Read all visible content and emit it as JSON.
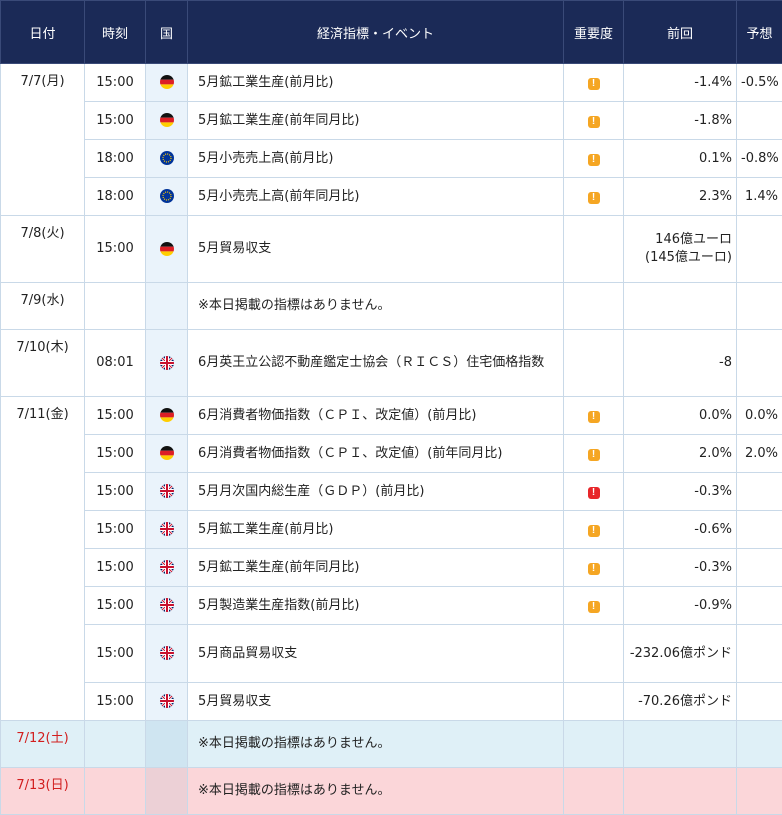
{
  "header": {
    "date": "日付",
    "time": "時刻",
    "country": "国",
    "event": "経済指標・イベント",
    "importance": "重要度",
    "previous": "前回",
    "forecast": "予想"
  },
  "icons": {
    "de": "germany-flag-icon",
    "eu": "eu-flag-icon",
    "gb": "uk-flag-icon",
    "importance_medium_color": "#f5a623",
    "importance_high_color": "#e8262a"
  },
  "days": [
    {
      "date": "7/7(月)",
      "rows": [
        {
          "time": "15:00",
          "flag": "de",
          "event": "5月鉱工業生産(前月比)",
          "importance": "medium",
          "previous": "-1.4%",
          "forecast": "-0.5%"
        },
        {
          "time": "15:00",
          "flag": "de",
          "event": "5月鉱工業生産(前年同月比)",
          "importance": "medium",
          "previous": "-1.8%",
          "forecast": ""
        },
        {
          "time": "18:00",
          "flag": "eu",
          "event": "5月小売売上高(前月比)",
          "importance": "medium",
          "previous": "0.1%",
          "forecast": "-0.8%"
        },
        {
          "time": "18:00",
          "flag": "eu",
          "event": "5月小売売上高(前年同月比)",
          "importance": "medium",
          "previous": "2.3%",
          "forecast": "1.4%"
        }
      ]
    },
    {
      "date": "7/8(火)",
      "rows": [
        {
          "time": "15:00",
          "flag": "de",
          "event": "5月貿易収支",
          "importance": "",
          "previous": "146億ユーロ",
          "previous_sub": "(145億ユーロ)",
          "forecast": ""
        }
      ]
    },
    {
      "date": "7/9(水)",
      "rows": [
        {
          "time": "",
          "flag": "",
          "event": "※本日掲載の指標はありません。",
          "importance": "",
          "previous": "",
          "forecast": ""
        }
      ]
    },
    {
      "date": "7/10(木)",
      "rows": [
        {
          "time": "08:01",
          "flag": "gb",
          "event": "6月英王立公認不動産鑑定士協会（ＲＩＣＳ）住宅価格指数",
          "importance": "",
          "previous": "-8",
          "forecast": ""
        }
      ]
    },
    {
      "date": "7/11(金)",
      "rows": [
        {
          "time": "15:00",
          "flag": "de",
          "event": "6月消費者物価指数（ＣＰＩ、改定値）(前月比)",
          "importance": "medium",
          "previous": "0.0%",
          "forecast": "0.0%"
        },
        {
          "time": "15:00",
          "flag": "de",
          "event": "6月消費者物価指数（ＣＰＩ、改定値）(前年同月比)",
          "importance": "medium",
          "previous": "2.0%",
          "forecast": "2.0%"
        },
        {
          "time": "15:00",
          "flag": "gb",
          "event": "5月月次国内総生産（ＧＤＰ）(前月比)",
          "importance": "high",
          "previous": "-0.3%",
          "forecast": ""
        },
        {
          "time": "15:00",
          "flag": "gb",
          "event": "5月鉱工業生産(前月比)",
          "importance": "medium",
          "previous": "-0.6%",
          "forecast": ""
        },
        {
          "time": "15:00",
          "flag": "gb",
          "event": "5月鉱工業生産(前年同月比)",
          "importance": "medium",
          "previous": "-0.3%",
          "forecast": ""
        },
        {
          "time": "15:00",
          "flag": "gb",
          "event": "5月製造業生産指数(前月比)",
          "importance": "medium",
          "previous": "-0.9%",
          "forecast": ""
        },
        {
          "time": "15:00",
          "flag": "gb",
          "event": "5月商品貿易収支",
          "importance": "",
          "previous": "-232.06億ポンド",
          "forecast": ""
        },
        {
          "time": "15:00",
          "flag": "gb",
          "event": "5月貿易収支",
          "importance": "",
          "previous": "-70.26億ポンド",
          "forecast": ""
        }
      ]
    },
    {
      "date": "7/12(土)",
      "rows": [
        {
          "time": "",
          "flag": "",
          "event": "※本日掲載の指標はありません。",
          "importance": "",
          "previous": "",
          "forecast": ""
        }
      ]
    },
    {
      "date": "7/13(日)",
      "rows": [
        {
          "time": "",
          "flag": "",
          "event": "※本日掲載の指標はありません。",
          "importance": "",
          "previous": "",
          "forecast": ""
        }
      ]
    }
  ]
}
